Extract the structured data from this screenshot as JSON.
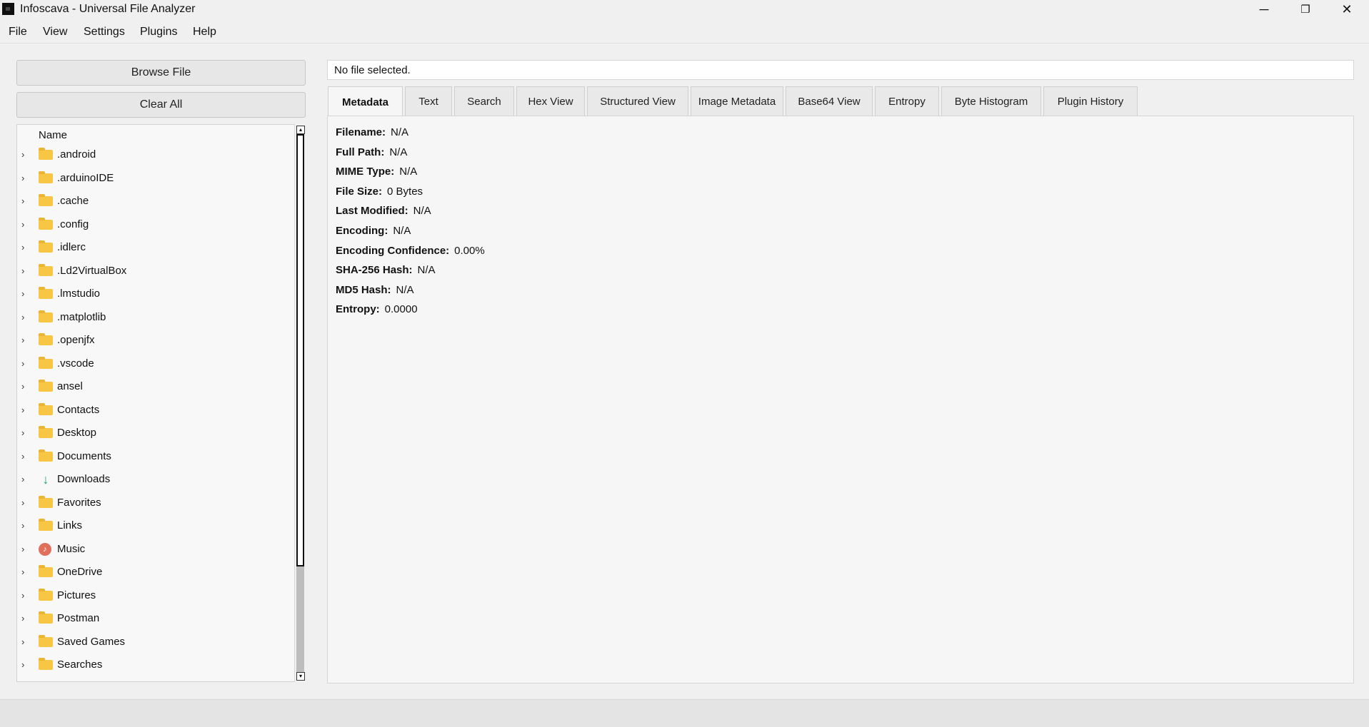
{
  "window": {
    "title": "Infoscava - Universal File Analyzer",
    "minimize_glyph": "─",
    "maximize_glyph": "❐",
    "close_glyph": "✕"
  },
  "menu": [
    "File",
    "View",
    "Settings",
    "Plugins",
    "Help"
  ],
  "left": {
    "browse_label": "Browse File",
    "clear_label": "Clear All",
    "tree_header": "Name",
    "items": [
      {
        "label": ".android",
        "icon": "folder-icon"
      },
      {
        "label": ".arduinoIDE",
        "icon": "folder-icon"
      },
      {
        "label": ".cache",
        "icon": "folder-icon"
      },
      {
        "label": ".config",
        "icon": "folder-icon"
      },
      {
        "label": ".idlerc",
        "icon": "folder-icon"
      },
      {
        "label": ".Ld2VirtualBox",
        "icon": "folder-icon"
      },
      {
        "label": ".lmstudio",
        "icon": "folder-icon"
      },
      {
        "label": ".matplotlib",
        "icon": "folder-icon"
      },
      {
        "label": ".openjfx",
        "icon": "folder-icon"
      },
      {
        "label": ".vscode",
        "icon": "folder-icon"
      },
      {
        "label": "ansel",
        "icon": "folder-icon"
      },
      {
        "label": "Contacts",
        "icon": "folder-icon"
      },
      {
        "label": "Desktop",
        "icon": "folder-icon"
      },
      {
        "label": "Documents",
        "icon": "folder-icon"
      },
      {
        "label": "Downloads",
        "icon": "download-icon"
      },
      {
        "label": "Favorites",
        "icon": "folder-icon"
      },
      {
        "label": "Links",
        "icon": "folder-icon"
      },
      {
        "label": "Music",
        "icon": "music-icon"
      },
      {
        "label": "OneDrive",
        "icon": "folder-icon"
      },
      {
        "label": "Pictures",
        "icon": "folder-icon"
      },
      {
        "label": "Postman",
        "icon": "folder-icon"
      },
      {
        "label": "Saved Games",
        "icon": "folder-icon"
      },
      {
        "label": "Searches",
        "icon": "folder-icon"
      }
    ]
  },
  "file_status": "No file selected.",
  "tabs": [
    {
      "label": "Metadata",
      "active": true
    },
    {
      "label": "Text"
    },
    {
      "label": "Search"
    },
    {
      "label": "Hex View"
    },
    {
      "label": "Structured View"
    },
    {
      "label": "Image Metadata"
    },
    {
      "label": "Base64 View"
    },
    {
      "label": "Entropy"
    },
    {
      "label": "Byte Histogram"
    },
    {
      "label": "Plugin History"
    }
  ],
  "metadata": [
    {
      "key": "Filename:",
      "value": "N/A"
    },
    {
      "key": "Full Path:",
      "value": "N/A"
    },
    {
      "key": "MIME Type:",
      "value": "N/A"
    },
    {
      "key": "File Size:",
      "value": "0 Bytes"
    },
    {
      "key": "Last Modified:",
      "value": "N/A"
    },
    {
      "key": "Encoding:",
      "value": "N/A"
    },
    {
      "key": "Encoding Confidence:",
      "value": "0.00%"
    },
    {
      "key": "SHA-256 Hash:",
      "value": "N/A"
    },
    {
      "key": "MD5 Hash:",
      "value": "N/A"
    },
    {
      "key": "Entropy:",
      "value": "0.0000"
    }
  ]
}
